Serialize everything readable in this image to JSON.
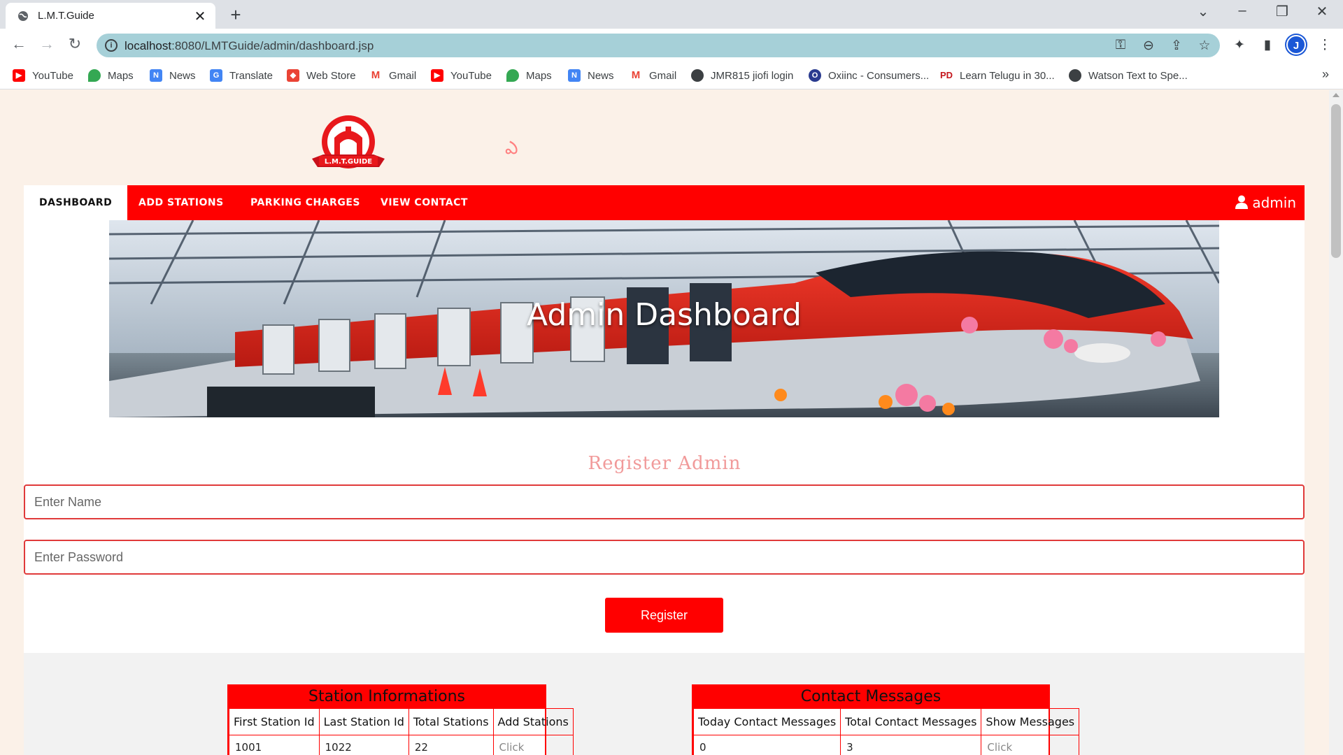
{
  "browser": {
    "tab_title": "L.M.T.Guide",
    "url_host": "localhost",
    "url_rest": ":8080/LMTGuide/admin/dashboard.jsp",
    "profile_initial": "J"
  },
  "bookmarks": [
    {
      "label": "YouTube",
      "icon": "youtube-icon",
      "color": "#ff0000"
    },
    {
      "label": "Maps",
      "icon": "maps-icon",
      "color": "#34a853"
    },
    {
      "label": "News",
      "icon": "news-icon",
      "color": "#4285f4"
    },
    {
      "label": "Translate",
      "icon": "translate-icon",
      "color": "#4285f4"
    },
    {
      "label": "Web Store",
      "icon": "webstore-icon",
      "color": "#ea4335"
    },
    {
      "label": "Gmail",
      "icon": "gmail-icon",
      "color": "#ea4335"
    },
    {
      "label": "YouTube",
      "icon": "youtube-icon",
      "color": "#ff0000"
    },
    {
      "label": "Maps",
      "icon": "maps-icon",
      "color": "#34a853"
    },
    {
      "label": "News",
      "icon": "news-icon",
      "color": "#4285f4"
    },
    {
      "label": "Gmail",
      "icon": "gmail-icon",
      "color": "#ea4335"
    },
    {
      "label": "JMR815 jiofi login",
      "icon": "globe-icon",
      "color": "#3c4043"
    },
    {
      "label": "Oxiinc - Consumers...",
      "icon": "oxiinc-icon",
      "color": "#2a3b8f"
    },
    {
      "label": "Learn Telugu in 30...",
      "icon": "pd-icon",
      "color": "#c4161c"
    },
    {
      "label": "Watson Text to Spe...",
      "icon": "globe-icon",
      "color": "#3c4043"
    }
  ],
  "header": {
    "logo_text": "L.M.T.GUIDE",
    "glyph": "ఎ"
  },
  "nav": {
    "items": [
      "DASHBOARD",
      "ADD STATIONS",
      "PARKING CHARGES",
      "VIEW CONTACT"
    ],
    "user": "admin"
  },
  "hero": {
    "title": "Admin Dashboard"
  },
  "register": {
    "title": "Register Admin",
    "name_placeholder": "Enter Name",
    "password_placeholder": "Enter Password",
    "button": "Register"
  },
  "station_panel": {
    "title": "Station Informations",
    "headers": [
      "First Station Id",
      "Last Station Id",
      "Total Stations",
      "Add Stations"
    ],
    "row": [
      "1001",
      "1022",
      "22",
      "Click"
    ]
  },
  "contact_panel": {
    "title": "Contact Messages",
    "headers": [
      "Today Contact Messages",
      "Total Contact Messages",
      "Show Messages"
    ],
    "row": [
      "0",
      "3",
      "Click"
    ]
  },
  "colors": {
    "accent": "#ff0000",
    "page_bg": "#fbf1e8",
    "omnibox": "#a6d0d8"
  }
}
